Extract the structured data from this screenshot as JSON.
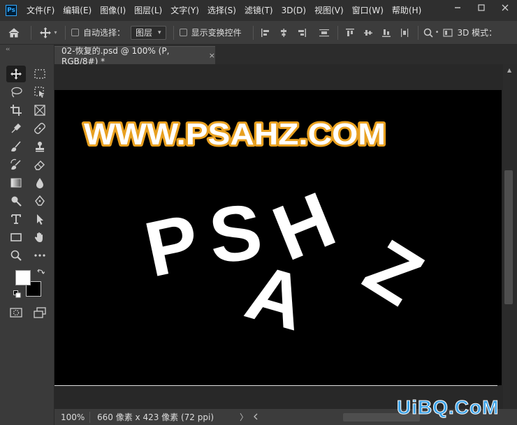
{
  "app": {
    "logo_text": "Ps",
    "menu": [
      "文件(F)",
      "编辑(E)",
      "图像(I)",
      "图层(L)",
      "文字(Y)",
      "选择(S)",
      "滤镜(T)",
      "3D(D)",
      "视图(V)",
      "窗口(W)",
      "帮助(H)"
    ]
  },
  "options_bar": {
    "auto_select_label": "自动选择：",
    "auto_select_value": "图层",
    "show_transform_label": "显示变换控件",
    "mode_3d_label": "3D 模式："
  },
  "document": {
    "tab_title": "02-恢复的.psd @ 100% (P, RGB/8#) *",
    "close_glyph": "×"
  },
  "canvas_art": {
    "headline": "WWW.PSAHZ.COM",
    "headline_fill": "#ffffff",
    "headline_stroke": "#e8a020",
    "letters": [
      "P",
      "S",
      "A",
      "H",
      "Z"
    ],
    "letters_fill": "#ffffff",
    "background": "#000000"
  },
  "status": {
    "zoom": "100%",
    "doc_info": "660 像素 x 423 像素 (72 ppi)",
    "arrow": "〉"
  },
  "watermark": {
    "text": "UiBQ.CoM",
    "color": "#3aa2e8"
  },
  "icons": {
    "home": "home-icon",
    "move": "move-icon",
    "collapse": "collapse-panel-icon"
  }
}
